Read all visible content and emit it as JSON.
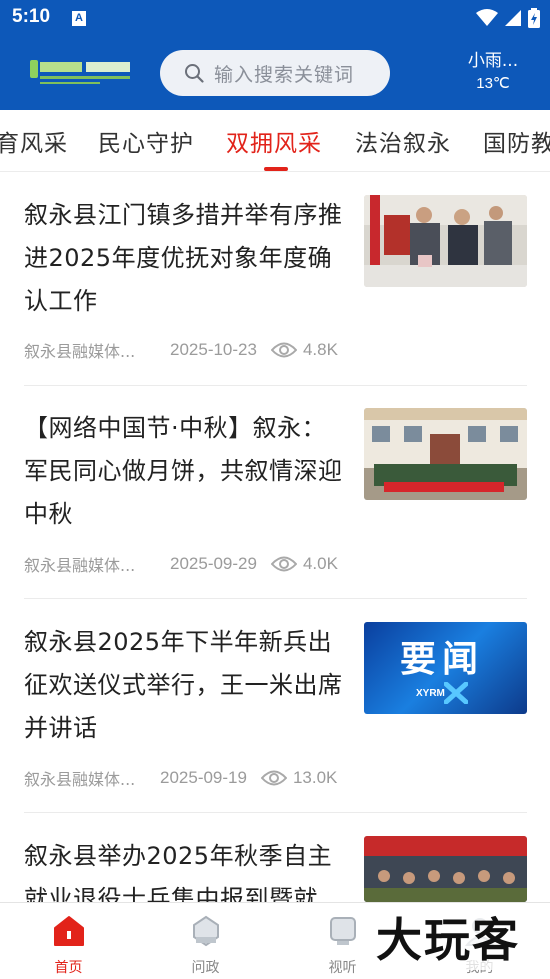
{
  "status_bar": {
    "time": "5:10",
    "notification_icon": "A"
  },
  "header": {
    "logo_text": "康养竹都 幸福叙永",
    "search_placeholder": "输入搜索关键词",
    "weather_condition": "小雨...",
    "weather_temp": "13℃"
  },
  "tabs": [
    {
      "label": "育风采"
    },
    {
      "label": "民心守护"
    },
    {
      "label": "双拥风采",
      "active": true
    },
    {
      "label": "法治叙永"
    },
    {
      "label": "国防教"
    }
  ],
  "articles": [
    {
      "title": "叙永县江门镇多措并举有序推进2025年度优抚对象年度确认工作",
      "source": "叙永县融媒体...",
      "date": "2025-10-23",
      "views": "4.8K",
      "thumbnail": "photo-veterans-office"
    },
    {
      "title": "【网络中国节·中秋】叙永：军民同心做月饼，共叙情深迎中秋",
      "source": "叙永县融媒体...",
      "date": "2025-09-29",
      "views": "4.0K",
      "thumbnail": "photo-group-building"
    },
    {
      "title": "叙永县2025年下半年新兵出征欢送仪式举行，王一米出席并讲话",
      "source": "叙永县融媒体...",
      "date": "2025-09-19",
      "views": "13.0K",
      "thumbnail_text": "要闻",
      "thumbnail_brand": "XYRM"
    },
    {
      "title": "叙永县举办2025年秋季自主就业退役士兵集中报到暨就",
      "thumbnail": "photo-meeting-hall"
    }
  ],
  "bottom_nav": [
    {
      "label": "首页",
      "icon": "home-icon",
      "active": true
    },
    {
      "label": "问政",
      "icon": "inquiry-icon"
    },
    {
      "label": "视听",
      "icon": "video-icon"
    },
    {
      "label": "我的",
      "icon": "profile-icon"
    }
  ],
  "watermark": "大玩客",
  "colors": {
    "brand_blue": "#0d58b9",
    "accent_red": "#e2231a"
  }
}
